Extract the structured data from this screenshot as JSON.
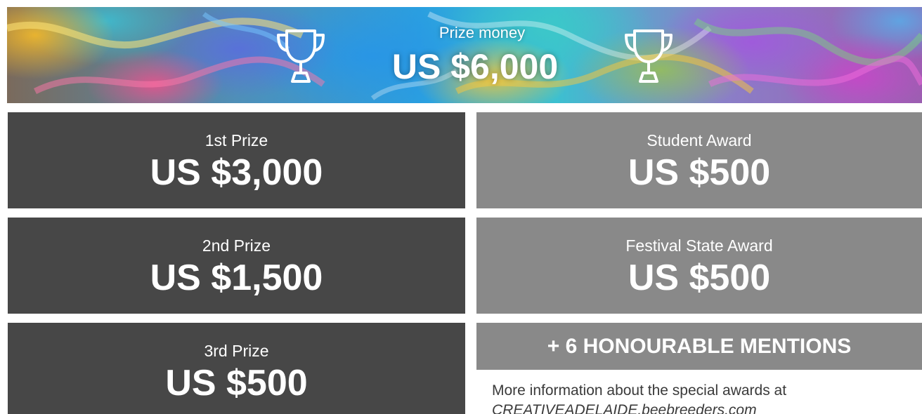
{
  "banner": {
    "label": "Prize money",
    "amount": "US $6,000"
  },
  "prizes": [
    {
      "label": "1st Prize",
      "amount": "US $3,000"
    },
    {
      "label": "2nd Prize",
      "amount": "US $1,500"
    },
    {
      "label": "3rd Prize",
      "amount": "US $500"
    }
  ],
  "awards": [
    {
      "label": "Student Award",
      "amount": "US $500"
    },
    {
      "label": "Festival State Award",
      "amount": "US $500"
    }
  ],
  "mentions": "+ 6 HONOURABLE MENTIONS",
  "more_info": {
    "text": "More information about the special awards at",
    "link": "CREATIVEADELAIDE.beebreeders.com"
  },
  "colors": {
    "dark_box": "#474747",
    "light_box": "#898989",
    "text_on_box": "#ffffff"
  },
  "icons": [
    "trophy-icon",
    "trophy-icon"
  ]
}
